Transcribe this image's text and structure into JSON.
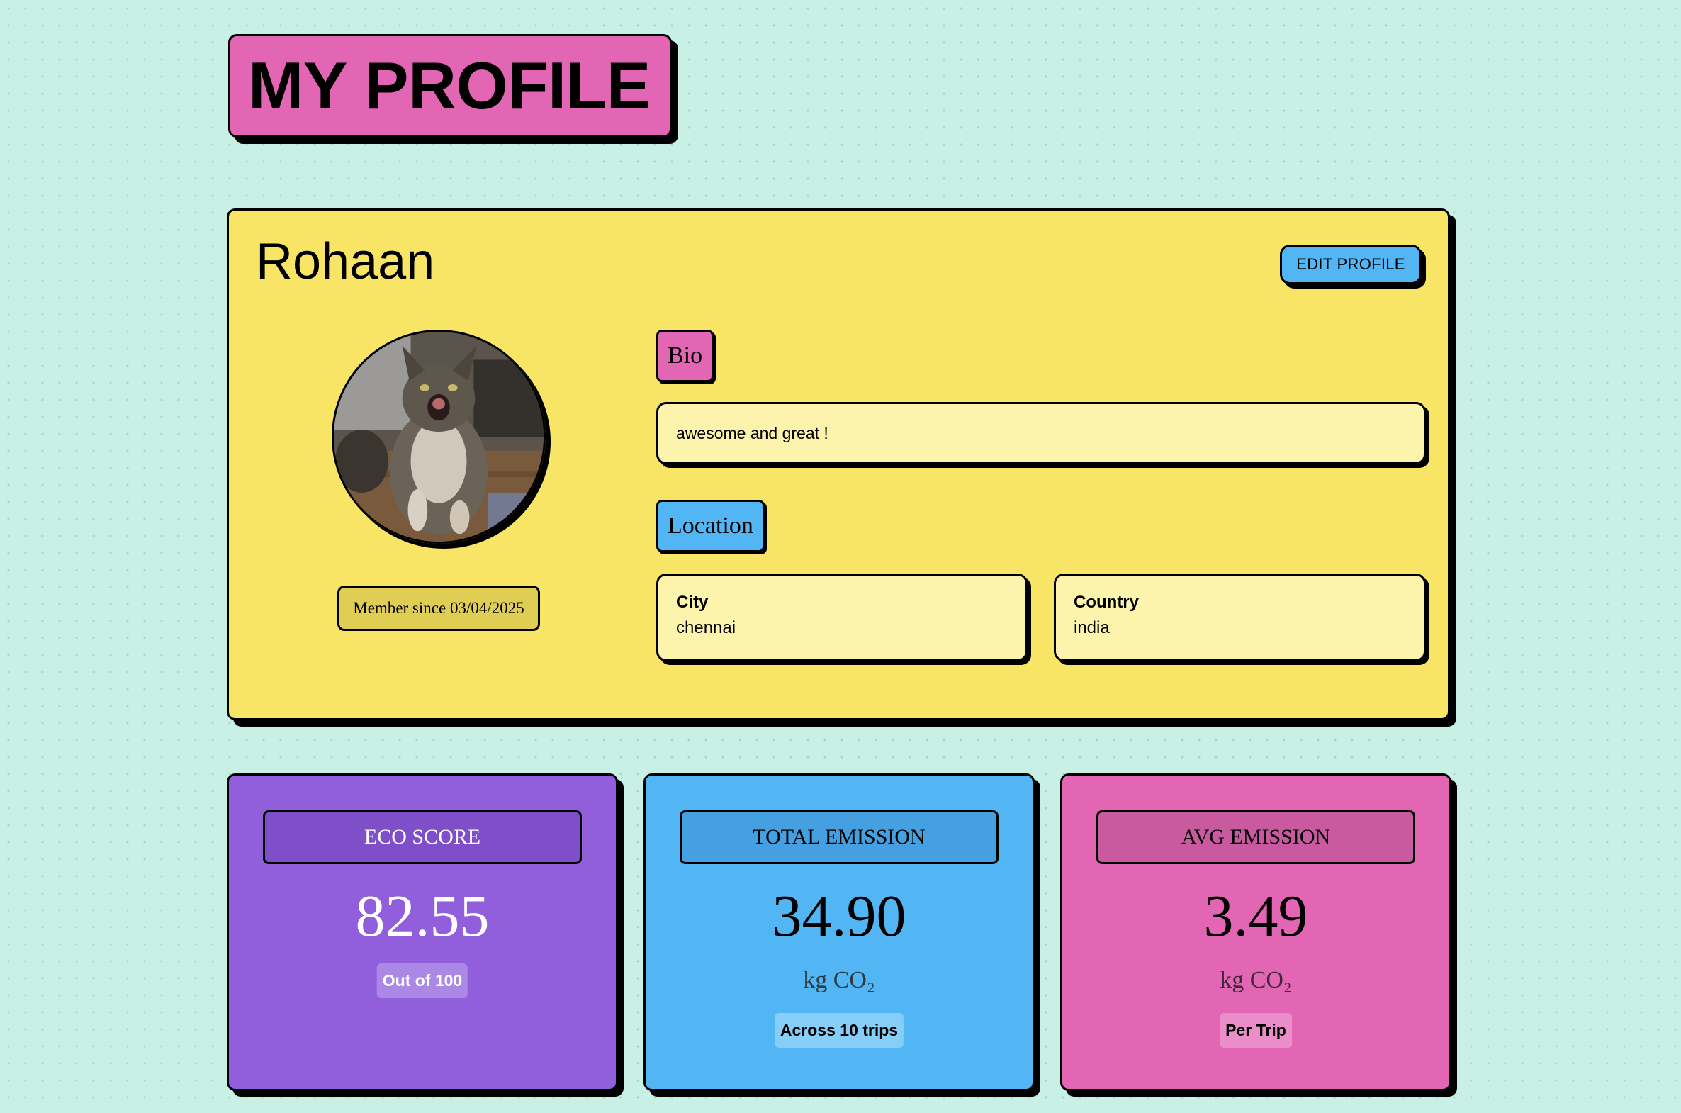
{
  "page": {
    "title": "MY PROFILE"
  },
  "profile": {
    "name": "Rohaan",
    "edit_button_label": "EDIT PROFILE",
    "avatar_image": "cat-photo",
    "member_since": "Member since 03/04/2025",
    "bio_label": "Bio",
    "bio_text": "awesome and great !",
    "location_label": "Location",
    "city_label": "City",
    "city_value": "chennai",
    "country_label": "Country",
    "country_value": "india"
  },
  "stats": [
    {
      "title": "ECO SCORE",
      "value": "82.55",
      "unit": "",
      "note": "Out of 100"
    },
    {
      "title": "TOTAL EMISSION",
      "value": "34.90",
      "unit": "kg CO₂",
      "note": "Across 10 trips"
    },
    {
      "title": "AVG EMISSION",
      "value": "3.49",
      "unit": "kg CO₂",
      "note": "Per Trip"
    }
  ],
  "colors": {
    "background": "#c9f0e4",
    "pink": "#e266b4",
    "yellow": "#f9e565",
    "blue": "#52b6f4",
    "purple": "#915fdc",
    "field_fill": "#fcf3ad"
  }
}
